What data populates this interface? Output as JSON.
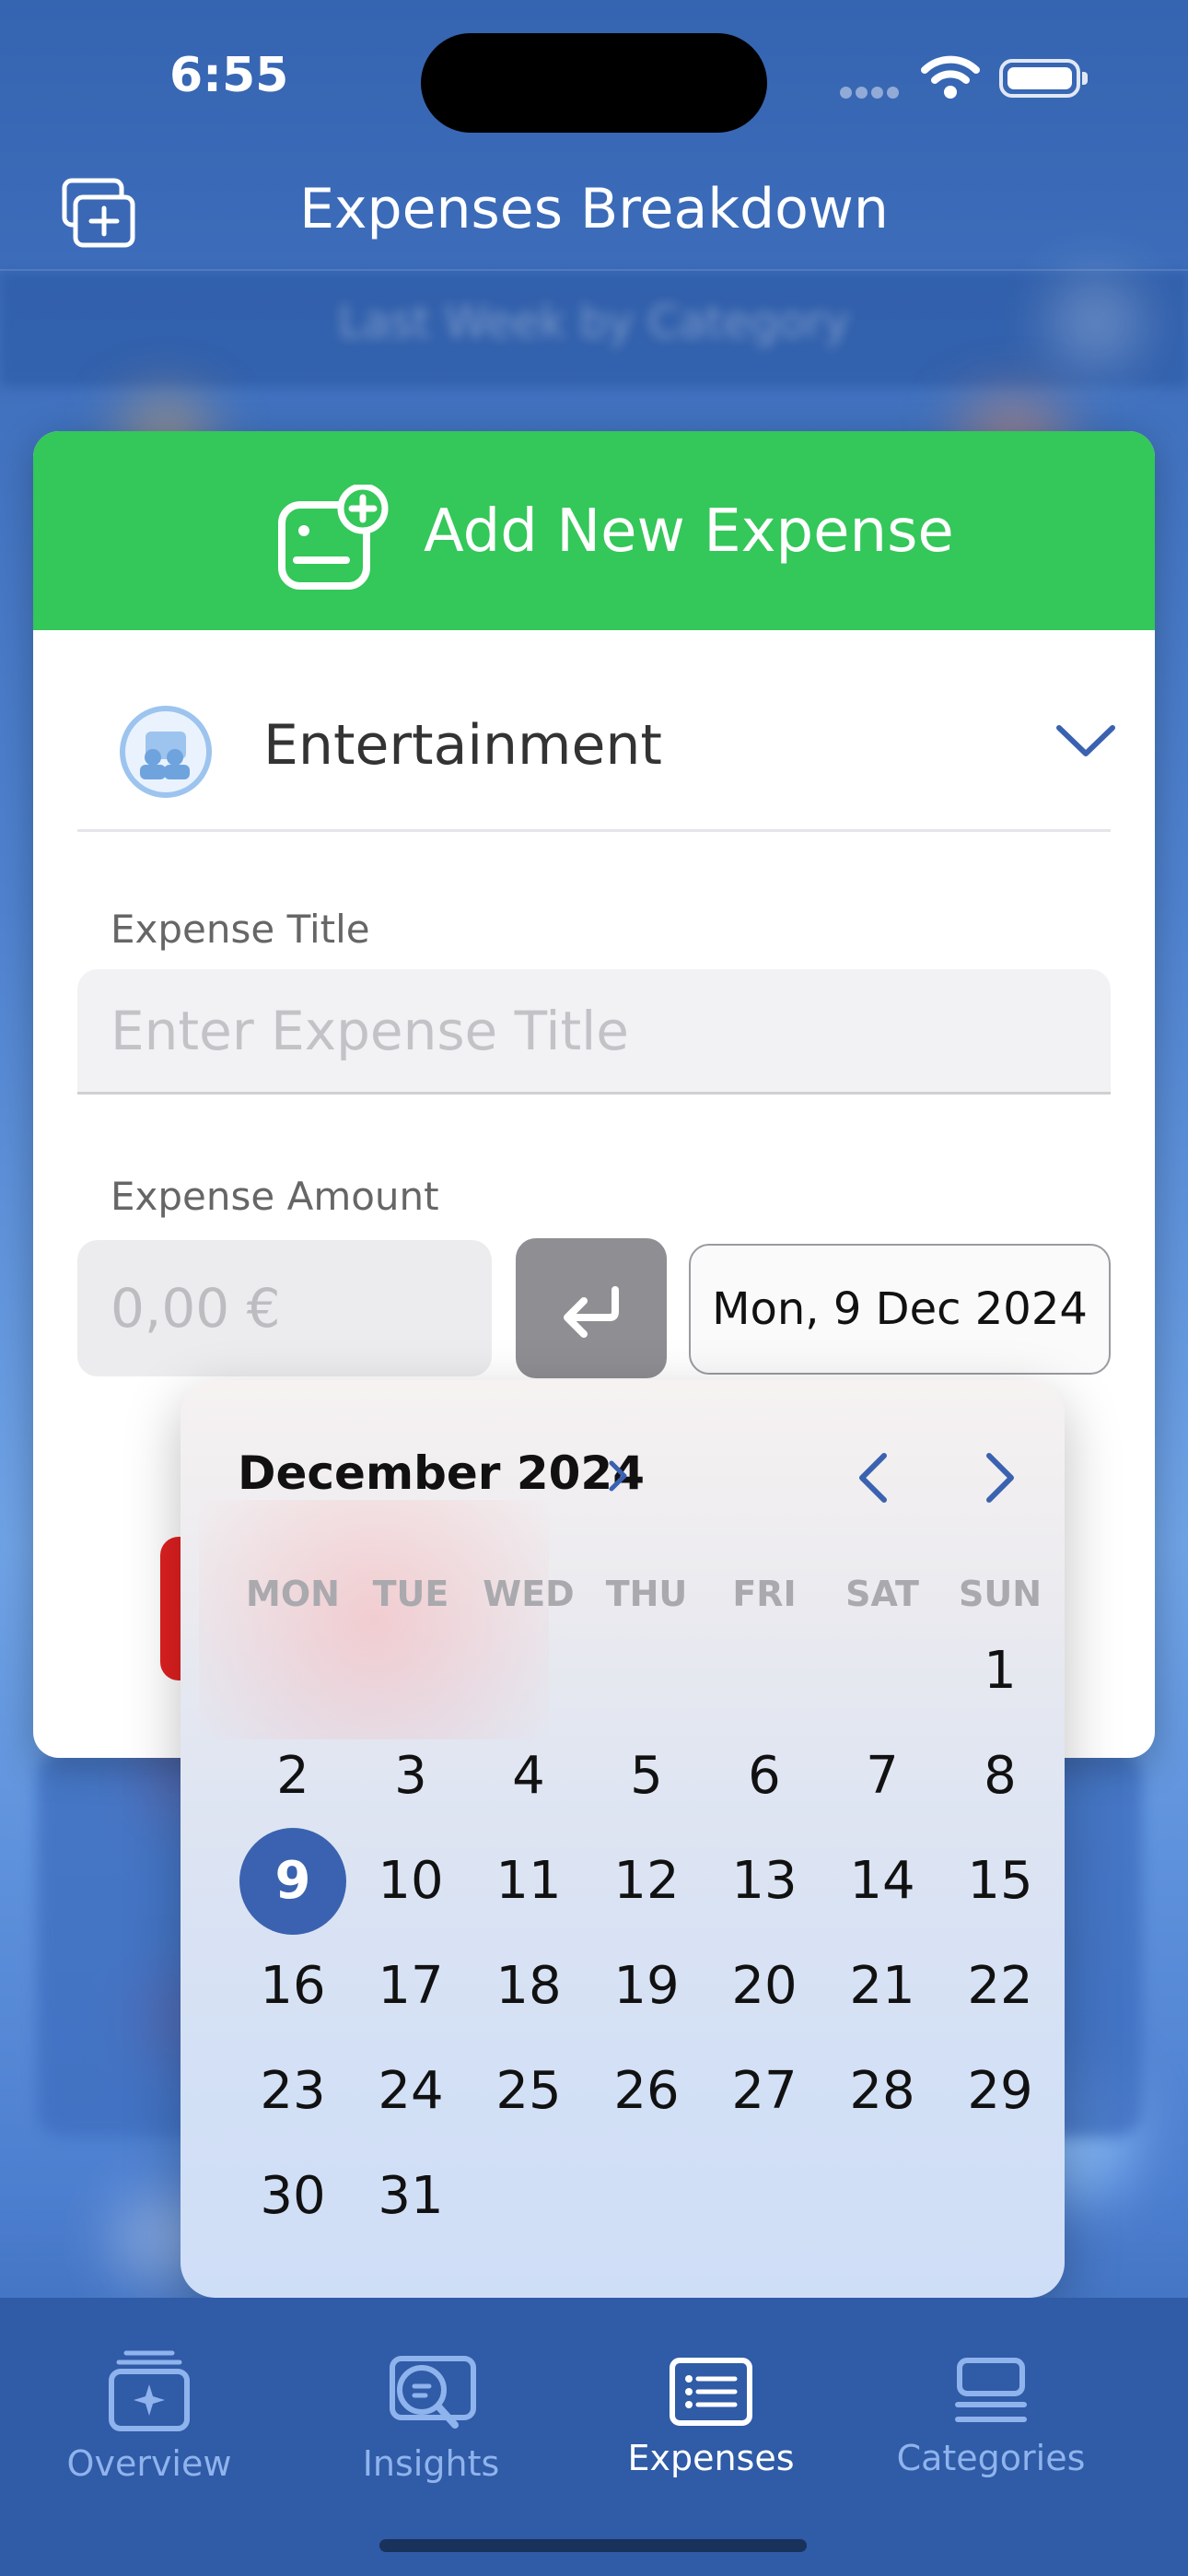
{
  "status_bar": {
    "time": "6:55"
  },
  "nav": {
    "title": "Expenses Breakdown"
  },
  "background": {
    "subtitle": "Last Week by Category"
  },
  "modal": {
    "header_title": "Add New Expense",
    "category": "Entertainment",
    "title_label": "Expense Title",
    "title_placeholder": "Enter Expense Title",
    "amount_label": "Expense Amount",
    "amount_placeholder": "0,00 €",
    "date_value": "Mon, 9 Dec 2024"
  },
  "calendar": {
    "month_label": "December 2024",
    "weekdays": [
      "MON",
      "TUE",
      "WED",
      "THU",
      "FRI",
      "SAT",
      "SUN"
    ],
    "first_weekday_index": 6,
    "days_in_month": 31,
    "selected_day": 9
  },
  "tabs": [
    {
      "label": "Overview",
      "icon": "overview-icon"
    },
    {
      "label": "Insights",
      "icon": "insights-icon"
    },
    {
      "label": "Expenses",
      "icon": "expenses-icon",
      "active": true
    },
    {
      "label": "Categories",
      "icon": "categories-icon"
    }
  ],
  "colors": {
    "header_green": "#34c759",
    "accent_blue": "#3a62b0",
    "tab_bar": "#2f5ba7",
    "inactive_tab": "#8fb3ec"
  }
}
